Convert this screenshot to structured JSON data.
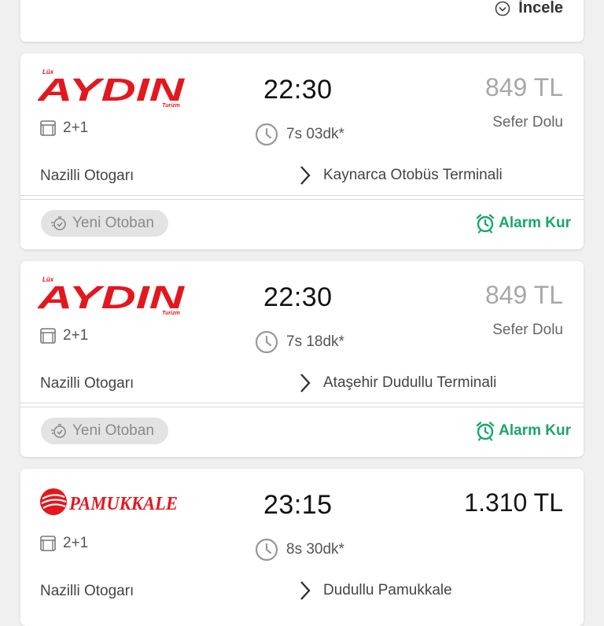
{
  "top_card": {
    "incele_label": "İncele",
    "incele_icon": "chevron-down-circle-icon"
  },
  "trips": [
    {
      "brand": "AYDIN",
      "logo": "aydin-logo",
      "logo_lux": "Lüx",
      "logo_turizm": "Turizm",
      "departure": "22:30",
      "price": "849 TL",
      "status": "Sefer Dolu",
      "seat_layout": "2+1",
      "duration": "7s 03dk*",
      "from": "Nazilli Otogarı",
      "to": "Kaynarca Otobüs Terminali",
      "badge": "Yeni Otoban",
      "alarm": "Alarm Kur"
    },
    {
      "brand": "AYDIN",
      "logo": "aydin-logo",
      "logo_lux": "Lüx",
      "logo_turizm": "Turizm",
      "departure": "22:30",
      "price": "849 TL",
      "status": "Sefer Dolu",
      "seat_layout": "2+1",
      "duration": "7s 18dk*",
      "from": "Nazilli Otogarı",
      "to": "Ataşehir Dudullu Terminali",
      "badge": "Yeni Otoban",
      "alarm": "Alarm Kur"
    },
    {
      "brand": "PAMUKKALE",
      "logo": "pamukkale-logo",
      "departure": "23:15",
      "price": "1.310 TL",
      "seat_layout": "2+1",
      "duration": "8s 30dk*",
      "from": "Nazilli Otogarı",
      "to": "Dudullu Pamukkale"
    }
  ],
  "colors": {
    "background": "#f0f0f0",
    "brand_red": "#e3171e",
    "alarm_green": "#1aa66c",
    "price_full_grey": "#a8a8a8"
  }
}
